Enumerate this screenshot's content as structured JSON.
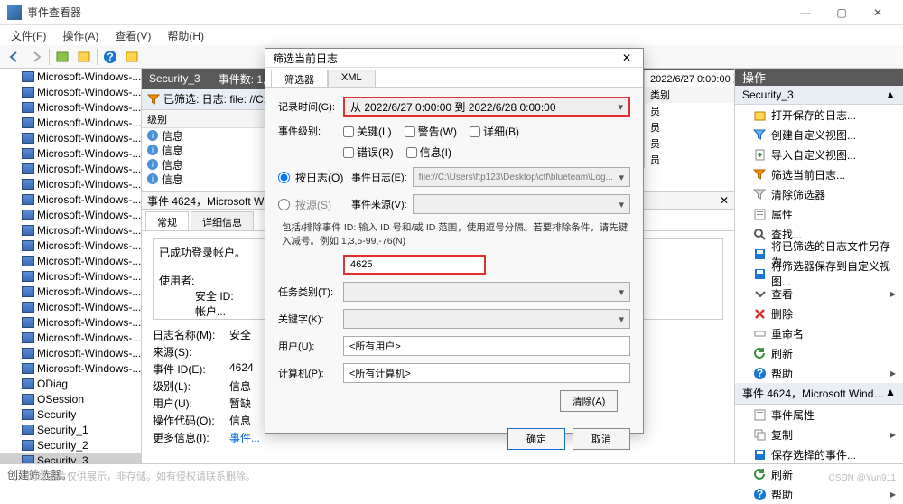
{
  "window": {
    "title": "事件查看器"
  },
  "menu": {
    "file": "文件(F)",
    "action": "操作(A)",
    "view": "查看(V)",
    "help": "帮助(H)"
  },
  "tree": {
    "items": [
      "Microsoft-Windows-...",
      "Microsoft-Windows-...",
      "Microsoft-Windows-...",
      "Microsoft-Windows-...",
      "Microsoft-Windows-...",
      "Microsoft-Windows-...",
      "Microsoft-Windows-...",
      "Microsoft-Windows-...",
      "Microsoft-Windows-...",
      "Microsoft-Windows-...",
      "Microsoft-Windows-...",
      "Microsoft-Windows-...",
      "Microsoft-Windows-...",
      "Microsoft-Windows-...",
      "Microsoft-Windows-...",
      "Microsoft-Windows-...",
      "Microsoft-Windows-...",
      "Microsoft-Windows-...",
      "Microsoft-Windows-...",
      "Microsoft-Windows-...",
      "ODiag",
      "OSession",
      "Security",
      "Security_1",
      "Security_2",
      "Security_3"
    ],
    "selected_index": 25
  },
  "center": {
    "header_title": "Security_3",
    "event_count_label": "事件数: 1,960",
    "filter_bar": "已筛选: 日志: file: //C:... 2022/6/28 0:00:00。事件...",
    "list_header": "级别",
    "rows": [
      "信息",
      "信息",
      "信息",
      "信息"
    ],
    "detail_title": "事件 4624，Microsoft Windows...",
    "tabs": {
      "general": "常规",
      "detail": "详细信息"
    },
    "body_title": "已成功登录帐户。",
    "subject_label": "使用者:",
    "sid_label": "安全 ID:",
    "account_label": "帐户...",
    "fields": {
      "log_name": {
        "label": "日志名称(M):",
        "value": "安全"
      },
      "source": {
        "label": "来源(S):"
      },
      "event_id": {
        "label": "事件 ID(E):",
        "value": "4624"
      },
      "level": {
        "label": "级别(L):",
        "value": "信息"
      },
      "user": {
        "label": "用户(U):",
        "value": "暂缺"
      },
      "opcode": {
        "label": "操作代码(O):",
        "value": "信息"
      },
      "more_info": {
        "label": "更多信息(I):",
        "value": "事件..."
      }
    }
  },
  "overlay": {
    "date": "2022/6/27 0:00:00  到",
    "category_header": "类别",
    "cat": "员"
  },
  "actions": {
    "header": "操作",
    "section1": "Security_3",
    "items1": [
      "打开保存的日志...",
      "创建自定义视图...",
      "导入自定义视图...",
      "筛选当前日志...",
      "清除筛选器",
      "属性",
      "查找...",
      "将已筛选的日志文件另存为...",
      "将筛选器保存到自定义视图...",
      "查看",
      "删除",
      "重命名",
      "刷新",
      "帮助"
    ],
    "section2": "事件 4624，Microsoft Windows sec...",
    "items2": [
      "事件属性",
      "复制",
      "保存选择的事件...",
      "刷新",
      "帮助"
    ]
  },
  "dialog": {
    "title": "筛选当前日志",
    "tabs": {
      "filter": "筛选器",
      "xml": "XML"
    },
    "record_time_label": "记录时间(G):",
    "record_time_value": "从 2022/6/27 0:00:00 到 2022/6/28 0:00:00",
    "event_level_label": "事件级别:",
    "cb_critical": "关键(L)",
    "cb_warning": "警告(W)",
    "cb_verbose": "详细(B)",
    "cb_error": "错误(R)",
    "cb_info": "信息(I)",
    "by_log": "按日志(O)",
    "by_source": "按源(S)",
    "event_log_label": "事件日志(E):",
    "event_log_value": "file://C:\\Users\\ftp123\\Desktop\\ctf\\blueteam\\Log...",
    "event_source_label": "事件来源(V):",
    "hint_text": "包括/排除事件 ID: 输入 ID 号和/或 ID 范围，使用逗号分隔。若要排除条件，请先键入减号。例如 1,3,5-99,-76(N)",
    "event_id_value": "4625",
    "task_category_label": "任务类别(T):",
    "keywords_label": "关键字(K):",
    "user_label": "用户(U):",
    "user_value": "<所有用户>",
    "computer_label": "计算机(P):",
    "computer_value": "<所有计算机>",
    "clear_btn": "清除(A)",
    "ok_btn": "确定",
    "cancel_btn": "取消"
  },
  "status": {
    "text": "创建筛选器。"
  },
  "watermark": "网络图片仅供展示，非存储。如有侵权请联系删除。",
  "csdn": "CSDN @Yun911"
}
